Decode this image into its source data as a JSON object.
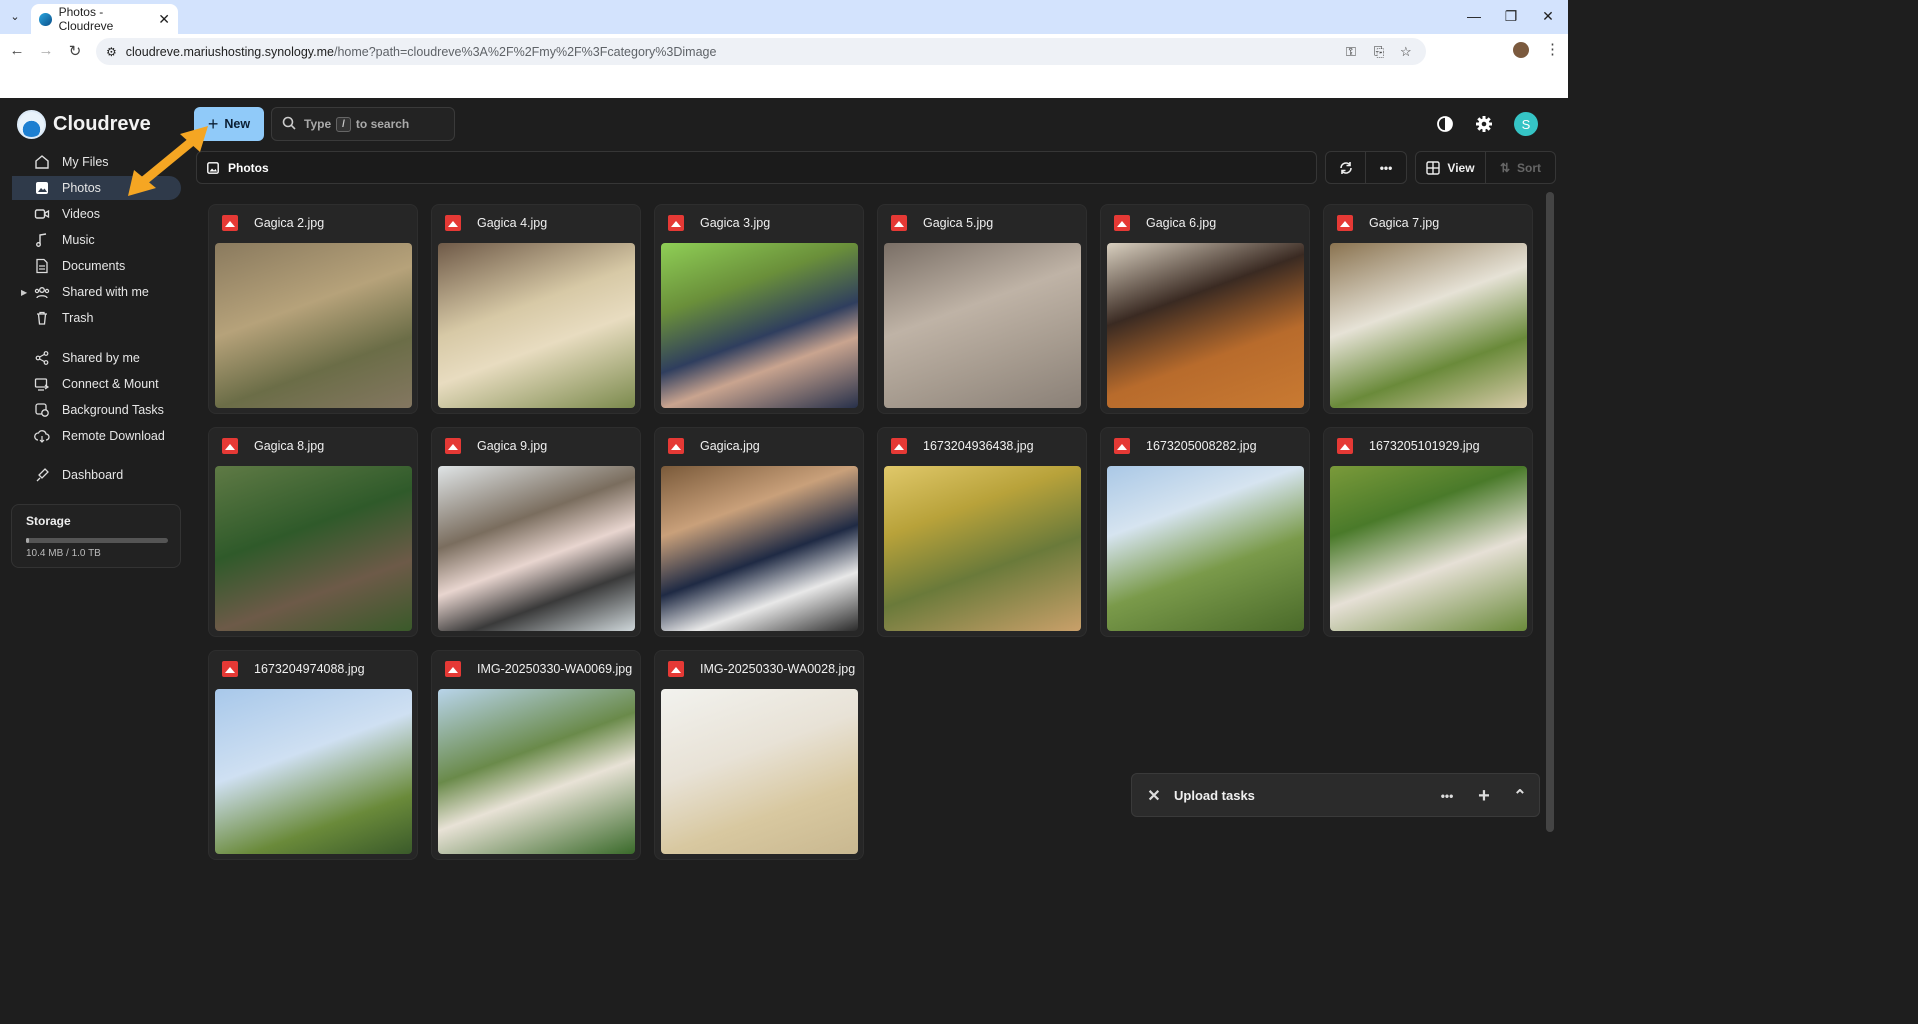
{
  "browser": {
    "tab_title": "Photos - Cloudreve",
    "url_host": "cloudreve.mariushosting.synology.me",
    "url_path": "/home?path=cloudreve%3A%2F%2Fmy%2F%3Fcategory%3Dimage"
  },
  "app": {
    "name": "Cloudreve"
  },
  "header": {
    "new_label": "New",
    "search_placeholder_a": "Type",
    "search_key": "/",
    "search_placeholder_b": "to search",
    "avatar_letter": "S"
  },
  "sidebar": {
    "items": [
      {
        "label": "My Files",
        "icon": "home-icon"
      },
      {
        "label": "Photos",
        "icon": "image-icon",
        "active": true
      },
      {
        "label": "Videos",
        "icon": "video-icon"
      },
      {
        "label": "Music",
        "icon": "music-icon"
      },
      {
        "label": "Documents",
        "icon": "document-icon"
      },
      {
        "label": "Shared with me",
        "icon": "people-icon"
      },
      {
        "label": "Trash",
        "icon": "trash-icon"
      },
      {
        "label": "Shared by me",
        "icon": "share-icon"
      },
      {
        "label": "Connect & Mount",
        "icon": "connect-icon"
      },
      {
        "label": "Background Tasks",
        "icon": "tasks-icon"
      },
      {
        "label": "Remote Download",
        "icon": "download-icon"
      },
      {
        "label": "Dashboard",
        "icon": "dashboard-icon"
      }
    ],
    "storage": {
      "title": "Storage",
      "usage": "10.4 MB / 1.0 TB",
      "fraction": 1e-05
    }
  },
  "breadcrumb": {
    "current": "Photos"
  },
  "view_toolbar": {
    "view_label": "View",
    "sort_label": "Sort"
  },
  "files": [
    {
      "name": "Gagica 2.jpg"
    },
    {
      "name": "Gagica 4.jpg"
    },
    {
      "name": "Gagica 3.jpg"
    },
    {
      "name": "Gagica 5.jpg"
    },
    {
      "name": "Gagica 6.jpg"
    },
    {
      "name": "Gagica 7.jpg"
    },
    {
      "name": "Gagica 8.jpg"
    },
    {
      "name": "Gagica 9.jpg"
    },
    {
      "name": "Gagica.jpg"
    },
    {
      "name": "1673204936438.jpg"
    },
    {
      "name": "1673205008282.jpg"
    },
    {
      "name": "1673205101929.jpg"
    },
    {
      "name": "1673204974088.jpg"
    },
    {
      "name": "IMG-20250330-WA0069.jpg"
    },
    {
      "name": "IMG-20250330-WA0028.jpg"
    }
  ],
  "upload_panel": {
    "title": "Upload tasks"
  },
  "colors": {
    "accent": "#90caf9",
    "file_icon": "#e53935",
    "avatar": "#35c4c5",
    "annotation_arrow": "#f5a623"
  }
}
